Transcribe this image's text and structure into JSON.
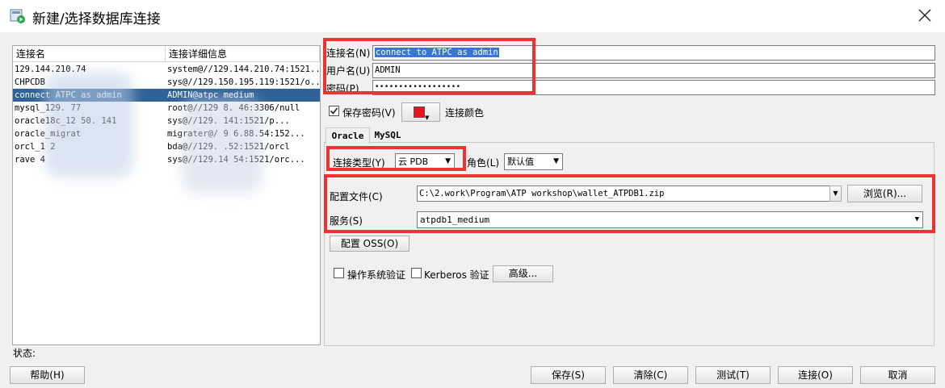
{
  "window": {
    "title": "新建/选择数据库连接",
    "close_symbol": "×"
  },
  "list": {
    "col_name": "连接名",
    "col_detail": "连接详细信息",
    "rows": [
      {
        "name": "129.144.210.74",
        "detail": "system@//129.144.210.74:1521..."
      },
      {
        "name": "CHPCDB",
        "detail": "sys@//129.150.195.119:1521/o..."
      },
      {
        "name": "connect    ATPC as admin",
        "detail": "ADMIN@atpc    medium"
      },
      {
        "name": "mysql_129.     77",
        "detail": "root@//129    8.    46:3306/null"
      },
      {
        "name": "oracle18c_12    50.    141",
        "detail": "sys@//129.    141:1521/p..."
      },
      {
        "name": "oracle_migrat",
        "detail": "migrater@/    9    6.88.54:152..."
      },
      {
        "name": "orcl_1        2",
        "detail": "bda@//129.    .52:1521/orcl"
      },
      {
        "name": "rave       4",
        "detail": "sys@//129.14    54:1521/orc..."
      }
    ]
  },
  "status_label": "状态:",
  "form": {
    "conn_name_label": "连接名(N)",
    "conn_name_value": "connect to ATPC as admin",
    "user_label": "用户名(U)",
    "user_value": "ADMIN",
    "password_label": "密码(P)",
    "password_value": "••••••••••••••••••",
    "save_password_label": "保存密码(V)",
    "conn_color_label": "连接颜色",
    "accent_color": "#e8141e"
  },
  "tabs": [
    {
      "label": "Oracle"
    },
    {
      "label": "MySQL"
    }
  ],
  "oracle": {
    "conn_type_label": "连接类型(Y)",
    "conn_type_value": "云 PDB",
    "role_label": "角色(L)",
    "role_value": "默认值",
    "config_file_label": "配置文件(C)",
    "config_file_value": "C:\\2.work\\Program\\ATP workshop\\wallet_ATPDB1.zip",
    "browse_label": "浏览(R)...",
    "service_label": "服务(S)",
    "service_value": "atpdb1_medium",
    "config_oss_label": "配置 OSS(O)",
    "os_auth_label": "操作系统验证",
    "kerberos_label": "Kerberos 验证",
    "advanced_label": "高级..."
  },
  "buttons": {
    "help": "帮助(H)",
    "save": "保存(S)",
    "clear": "清除(C)",
    "test": "测试(T)",
    "connect": "连接(O)",
    "cancel": "取消"
  }
}
